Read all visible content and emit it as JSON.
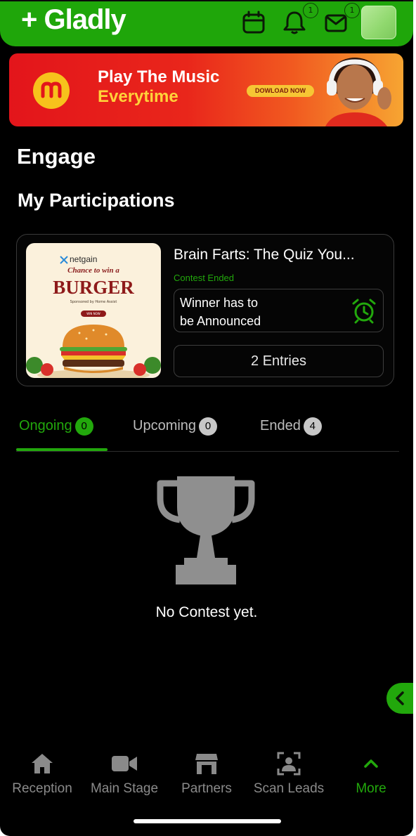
{
  "header": {
    "logo": "+ Gladly",
    "notifications_count": "1",
    "messages_count": "1"
  },
  "banner": {
    "line1": "Play The Music",
    "line2": "Everytime",
    "button": "DOWLOAD NOW"
  },
  "page": {
    "title": "Engage",
    "section_title": "My Participations"
  },
  "contest": {
    "title": "Brain Farts: The Quiz You...",
    "status": "Contest Ended",
    "winner_line1": "Winner has to",
    "winner_line2": "be Announced",
    "entries": "2 Entries",
    "thumb": {
      "brand": "netgain",
      "chance": "Chance to win a",
      "headline": "BURGER",
      "sponsor": "Sponsored by Home Assist",
      "cta": "WIN NOW"
    }
  },
  "tabs": [
    {
      "label": "Ongoing",
      "count": "0"
    },
    {
      "label": "Upcoming",
      "count": "0"
    },
    {
      "label": "Ended",
      "count": "4"
    }
  ],
  "empty_state": "No Contest yet.",
  "nav": [
    {
      "label": "Reception",
      "icon": "home-icon"
    },
    {
      "label": "Main Stage",
      "icon": "video-icon"
    },
    {
      "label": "Partners",
      "icon": "store-icon"
    },
    {
      "label": "Scan Leads",
      "icon": "scan-user-icon"
    },
    {
      "label": "More",
      "icon": "chevron-up-icon"
    }
  ],
  "colors": {
    "brand_green": "#22a80c",
    "background": "#000000",
    "banner_red": "#e3151b",
    "banner_yellow": "#ffd23a"
  }
}
